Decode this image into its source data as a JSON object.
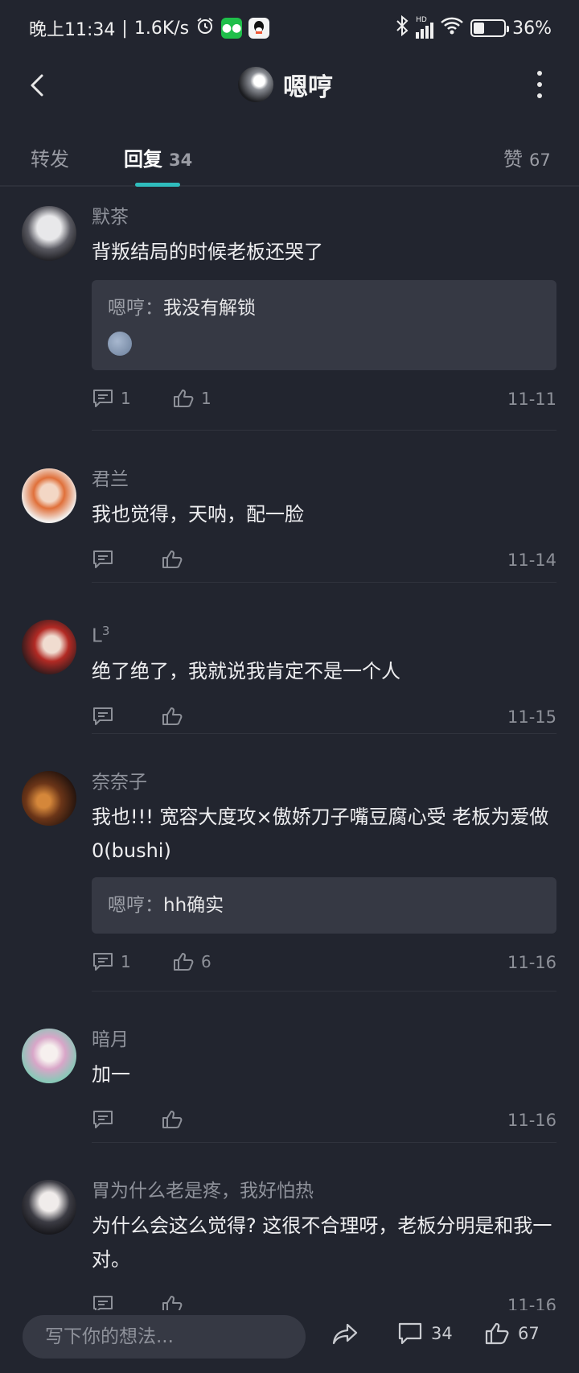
{
  "status_bar": {
    "time": "晚上11:34",
    "separator": "|",
    "net_speed": "1.6K/s",
    "alarm_icon": "alarm-clock-icon",
    "apps": [
      "wechat-icon",
      "qq-icon"
    ],
    "signal_label": "HD",
    "battery": "36%",
    "battery_level": 0.36
  },
  "header": {
    "title": "嗯哼",
    "back_icon": "chevron-left-icon",
    "more_icon": "more-vertical-icon"
  },
  "tabs": {
    "repost_label": "转发",
    "reply_label": "回复",
    "reply_count": "34",
    "like_label": "赞",
    "like_count": "67"
  },
  "colors": {
    "background": "#22252f",
    "accent": "#2fbdbd",
    "reply_box": "#363944"
  },
  "comments": [
    {
      "user": "默茶",
      "text": "背叛结局的时候老板还哭了",
      "reply": {
        "author": "嗯哼",
        "sep": "：",
        "text": "我没有解锁",
        "emoji": "moon-face-emoji"
      },
      "comment_count": "1",
      "like_count": "1",
      "date": "11-11"
    },
    {
      "user": "君兰",
      "text": "我也觉得，天呐，配一脸",
      "comment_count": "",
      "like_count": "",
      "date": "11-14"
    },
    {
      "user": "L",
      "user_sup": "3",
      "text": "绝了绝了，我就说我肯定不是一个人",
      "comment_count": "",
      "like_count": "",
      "date": "11-15"
    },
    {
      "user": "奈奈子",
      "text": "我也!!! 宽容大度攻×傲娇刀子嘴豆腐心受    老板为爱做0(bushi)",
      "reply": {
        "author": "嗯哼",
        "sep": "：",
        "text": "hh确实"
      },
      "comment_count": "1",
      "like_count": "6",
      "date": "11-16"
    },
    {
      "user": "暗月",
      "text": "加一",
      "comment_count": "",
      "like_count": "",
      "date": "11-16"
    },
    {
      "user": "胃为什么老是疼，我好怕热",
      "text": "为什么会这么觉得? 这很不合理呀，老板分明是和我一对。",
      "comment_count": "",
      "like_count": "",
      "date": "11-16"
    }
  ],
  "bottom_bar": {
    "input_placeholder": "写下你的想法...",
    "share_icon": "share-icon",
    "comment_count": "34",
    "like_count": "67"
  }
}
